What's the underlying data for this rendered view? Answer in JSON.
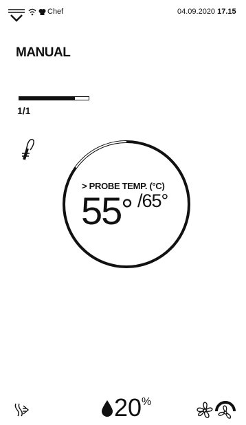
{
  "status_bar": {
    "user_name": "Chef",
    "date": "04.09.2020",
    "time": "17.15"
  },
  "program": {
    "mode_title": "MANUAL",
    "phase_counter": "1/1",
    "phase_progress": 0.8
  },
  "probe": {
    "label": "> PROBE TEMP. (°C)",
    "current_value": "55",
    "current_unit": "°",
    "target_value": "/65°",
    "progress_fraction": 0.15
  },
  "bottom_bar": {
    "humidity_value": "20",
    "humidity_unit": "%"
  },
  "icons": [
    "menu-dropdown-icon",
    "wifi-icon",
    "chef-hat-icon",
    "probe-icon",
    "steam-vent-icon",
    "humidity-drop-icon",
    "fan-icon",
    "fan-speed-icon"
  ]
}
